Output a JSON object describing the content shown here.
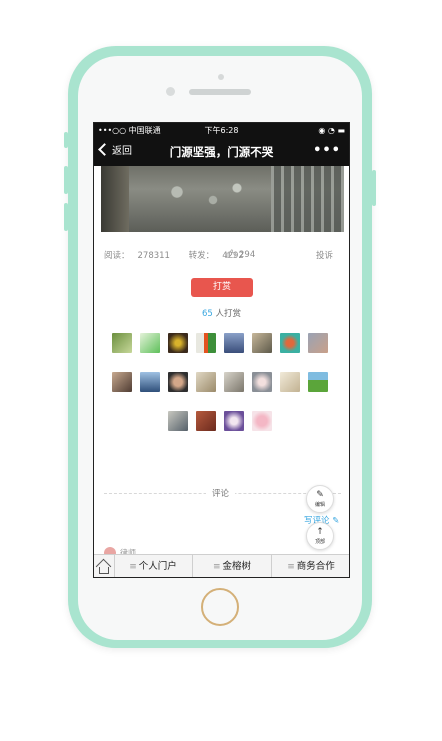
{
  "statusbar": {
    "carrier": "•••○○ 中国联通 ",
    "time": "下午6:28",
    "battery": "◉ ◔ ▬"
  },
  "navbar": {
    "back_label": "返回",
    "title": "门源坚强，门源不哭",
    "more": "•••"
  },
  "stats": {
    "read_label": "阅读：",
    "read_value": "278311",
    "share_label": "转发：",
    "share_value": "4292",
    "like_value": "294",
    "complain_label": "投诉"
  },
  "reward": {
    "button_label": "打赏",
    "count": "65",
    "count_suffix": " 人打赏"
  },
  "comments": {
    "section_label": "评论",
    "write_label": "写评论",
    "edit_label": "编辑",
    "top_label": "顶部",
    "first_commenter": "律师"
  },
  "bottom_nav": {
    "items": [
      {
        "label": "个人门户"
      },
      {
        "label": "金榕树"
      },
      {
        "label": "商务合作"
      }
    ]
  },
  "colors": {
    "phone_frame": "#a9e4cf",
    "reward_button": "#e8564e",
    "accent_blue": "#3aa7e0",
    "nav_bg": "#111111"
  }
}
